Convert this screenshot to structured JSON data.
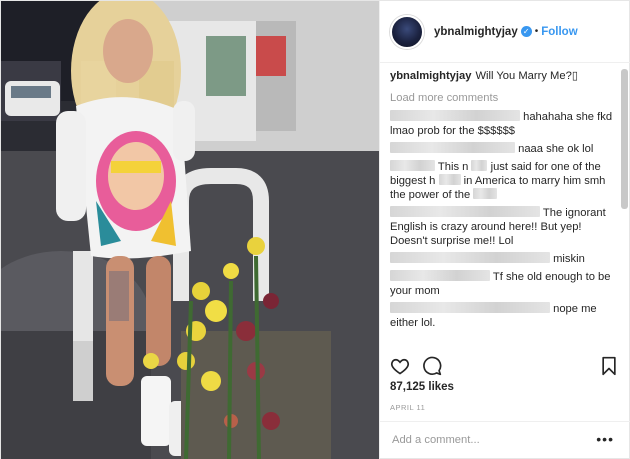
{
  "header": {
    "username": "ybnalmightyjay",
    "separator": "•",
    "follow_label": "Follow"
  },
  "caption": {
    "username": "ybnalmightyjay",
    "text": "Will You Marry Me?▯"
  },
  "load_more": "Load more comments",
  "comments": [
    {
      "text": "hahahaha she fkd lmao prob for the $$$$$$"
    },
    {
      "text": "naaa she ok lol"
    },
    {
      "text_a": "This n",
      "text_b": "just said for one of the biggest h",
      "text_c": "in America to marry him smh the power of the"
    },
    {
      "text": "The ignorant English is crazy around here!! But yep! Doesn't surprise me!! Lol"
    },
    {
      "text": "miskin"
    },
    {
      "text": "Tf she old enough to be your mom"
    },
    {
      "text": "nope me either lol."
    }
  ],
  "likes": "87,125 likes",
  "date": "APRIL 11",
  "add_comment_placeholder": "Add a comment...",
  "more_icon": "•••",
  "colors": {
    "link": "#3897f0",
    "muted": "#999999"
  }
}
